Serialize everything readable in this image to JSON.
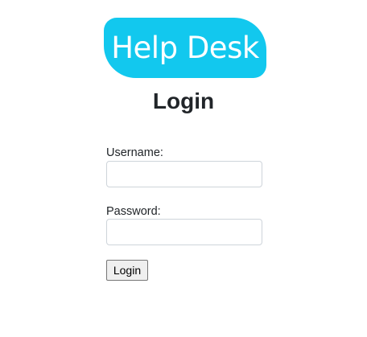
{
  "logo": {
    "text": "Help Desk",
    "color": "#12c8ee"
  },
  "heading": "Login",
  "form": {
    "username_label": "Username:",
    "username_value": "",
    "password_label": "Password:",
    "password_value": "",
    "submit_label": "Login"
  }
}
